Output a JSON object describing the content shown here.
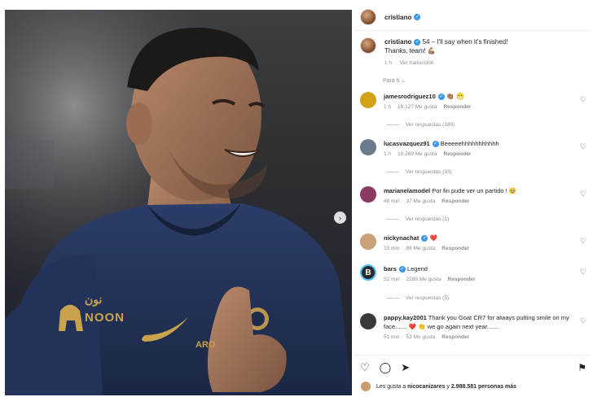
{
  "post": {
    "author": "cristiano",
    "caption_author": "cristiano",
    "caption_text": "54 – I'll say when it's finished!",
    "caption_text2": "Thanks, team! 💪🏽",
    "caption_time": "1 h",
    "see_translation": "Ver traducción",
    "jersey_sponsor": "ﻧﻮﻥ",
    "jersey_sponsor_latin": "NOON",
    "jersey_partner": "ARO"
  },
  "sort_label": "Para ti",
  "comments": [
    {
      "user": "jamesrodriguez10",
      "verified": true,
      "text": "👏🏽 😁",
      "time": "1 h",
      "likes": "19.127 Me gusta",
      "reply": "Responder",
      "replies": "Ver respuestas (189)",
      "avatar_color": "#d4a017"
    },
    {
      "user": "lucasvazquez91",
      "verified": true,
      "text": "Beeeeehhhhhhhhhhh",
      "time": "1 h",
      "likes": "10.269 Me gusta",
      "reply": "Responder",
      "replies": "Ver respuestas (93)",
      "avatar_color": "#6b7b8c"
    },
    {
      "user": "marianelamodel",
      "verified": false,
      "text": "Por fin pude ver un partido ! 🥹",
      "time": "48 min",
      "likes": "37 Me gusta",
      "reply": "Responder",
      "replies": "Ver respuestas (1)",
      "avatar_color": "#8b3a62"
    },
    {
      "user": "nickynachat",
      "verified": true,
      "text": "❤️",
      "time": "15 min",
      "likes": "88 Me gusta",
      "reply": "Responder",
      "replies": "",
      "avatar_color": "#c9a27a"
    },
    {
      "user": "bars",
      "verified": true,
      "text": "Legend",
      "time": "52 min",
      "likes": "2289 Me gusta",
      "reply": "Responder",
      "replies": "Ver respuestas (5)",
      "avatar_color": "#2a2a2a"
    },
    {
      "user": "pappy.kay2001",
      "verified": false,
      "text": "Thank you Goat CR7 for always putting smile on my face....... ❤️ 👏 we go again next year.......",
      "time": "51 min",
      "likes": "53 Me gusta",
      "reply": "Responder",
      "replies": "",
      "avatar_color": "#3a3a3a"
    }
  ],
  "actions": {
    "like_icon": "heart-icon",
    "comment_icon": "comment-icon",
    "share_icon": "share-icon",
    "save_icon": "bookmark-icon"
  },
  "likes_summary": {
    "prefix": "Les gusta a",
    "user": "nicocanizares",
    "connector": "y",
    "count": "2.988.581",
    "suffix": "personas más"
  },
  "colors": {
    "verified": "#3897f0",
    "secondary_text": "#8e8e8e",
    "heart_red": "#ed4956"
  }
}
